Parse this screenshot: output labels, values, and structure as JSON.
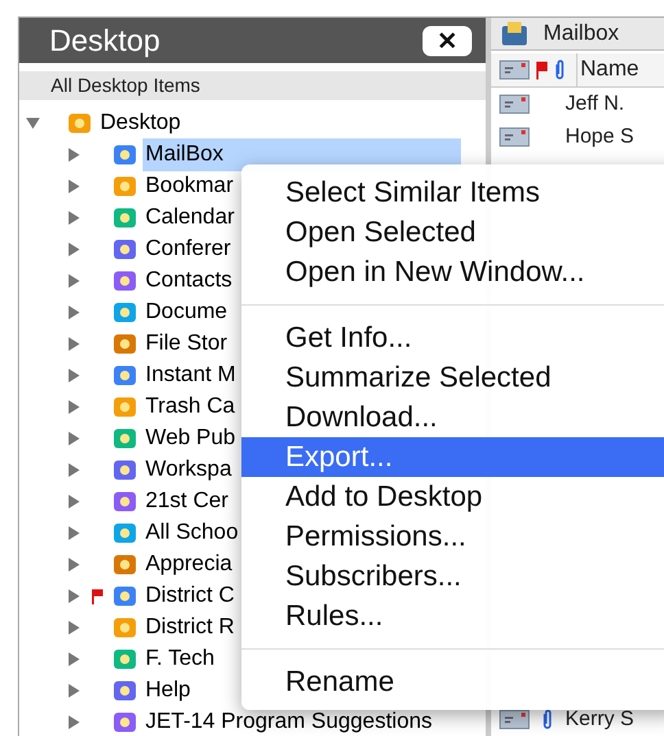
{
  "sidebar": {
    "title": "Desktop",
    "close_label": "✕",
    "filter": "All Desktop Items",
    "tree": {
      "label": "Desktop",
      "expanded": true,
      "selected": false,
      "flagged": false,
      "children": [
        {
          "label": "MailBox",
          "expanded": false,
          "selected": true,
          "flagged": false
        },
        {
          "label": "Bookmar",
          "expanded": false,
          "selected": false,
          "flagged": false
        },
        {
          "label": "Calendar",
          "expanded": false,
          "selected": false,
          "flagged": false
        },
        {
          "label": "Conferer",
          "expanded": false,
          "selected": false,
          "flagged": false
        },
        {
          "label": "Contacts",
          "expanded": false,
          "selected": false,
          "flagged": false
        },
        {
          "label": "Docume",
          "expanded": false,
          "selected": false,
          "flagged": false
        },
        {
          "label": "File Stor",
          "expanded": false,
          "selected": false,
          "flagged": false
        },
        {
          "label": "Instant M",
          "expanded": false,
          "selected": false,
          "flagged": false
        },
        {
          "label": "Trash Ca",
          "expanded": false,
          "selected": false,
          "flagged": false
        },
        {
          "label": "Web Pub",
          "expanded": false,
          "selected": false,
          "flagged": false
        },
        {
          "label": "Workspa",
          "expanded": false,
          "selected": false,
          "flagged": false
        },
        {
          "label": "21st Cer",
          "expanded": false,
          "selected": false,
          "flagged": false
        },
        {
          "label": "All Schoo",
          "expanded": false,
          "selected": false,
          "flagged": false
        },
        {
          "label": "Apprecia",
          "expanded": false,
          "selected": false,
          "flagged": false
        },
        {
          "label": "District C",
          "expanded": false,
          "selected": false,
          "flagged": true
        },
        {
          "label": "District R",
          "expanded": false,
          "selected": false,
          "flagged": false
        },
        {
          "label": "F. Tech",
          "expanded": false,
          "selected": false,
          "flagged": false
        },
        {
          "label": "Help",
          "expanded": false,
          "selected": false,
          "flagged": false
        },
        {
          "label": "JET-14 Program Suggestions",
          "expanded": false,
          "selected": false,
          "flagged": false
        }
      ]
    }
  },
  "mailbox": {
    "title": "Mailbox",
    "columns": {
      "name": "Name"
    },
    "rows": [
      {
        "name": "Jeff N.",
        "attachment": false
      },
      {
        "name": "Hope S",
        "attachment": false
      }
    ],
    "bottom_row": {
      "name": "Kerry S",
      "attachment": true
    }
  },
  "context_menu": {
    "groups": [
      [
        {
          "label": "Select Similar Items",
          "selected": false
        },
        {
          "label": "Open Selected",
          "selected": false
        },
        {
          "label": "Open in New Window...",
          "selected": false
        }
      ],
      [
        {
          "label": "Get Info...",
          "selected": false
        },
        {
          "label": "Summarize Selected",
          "selected": false
        },
        {
          "label": "Download...",
          "selected": false
        },
        {
          "label": "Export...",
          "selected": true
        },
        {
          "label": "Add to Desktop",
          "selected": false
        },
        {
          "label": "Permissions...",
          "selected": false
        },
        {
          "label": "Subscribers...",
          "selected": false
        },
        {
          "label": "Rules...",
          "selected": false
        }
      ],
      [
        {
          "label": "Rename",
          "selected": false
        }
      ]
    ]
  }
}
